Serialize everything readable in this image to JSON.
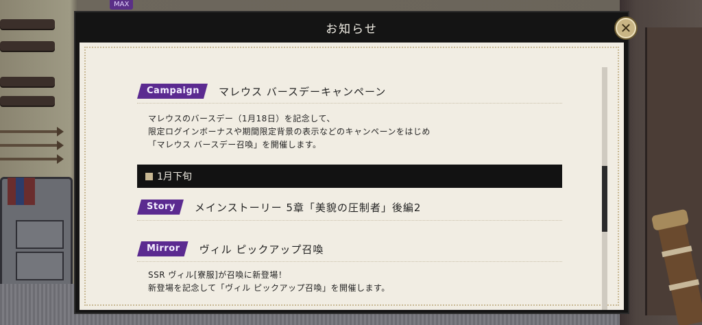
{
  "hud": {
    "max_label": "MAX"
  },
  "dialog": {
    "title": "お知らせ",
    "close_icon": "close-icon"
  },
  "entries": [
    {
      "tag": "Campaign",
      "title": "マレウス バースデーキャンペーン",
      "lines": [
        "マレウスのバースデー（1月18日）を記念して、",
        "限定ログインボーナスや期間限定背景の表示などのキャンペーンをはじめ",
        "「マレウス バースデー召喚」を開催します。"
      ]
    },
    {
      "tag": "Story",
      "title": "メインストーリー 5章「美貌の圧制者」後編2",
      "lines": []
    },
    {
      "tag": "Mirror",
      "title": "ヴィル ピックアップ召喚",
      "lines": [
        "SSR ヴィル[寮服]が召喚に新登場！",
        "新登場を記念して「ヴィル ピックアップ召喚」を開催します。"
      ]
    }
  ],
  "section": {
    "date_label": "1月下旬"
  },
  "scrollbar": {
    "position": 0.56
  },
  "colors": {
    "tag": "#5b2a90",
    "paper": "#f1ede3",
    "frame": "#141414",
    "accent": "#c8b893"
  }
}
